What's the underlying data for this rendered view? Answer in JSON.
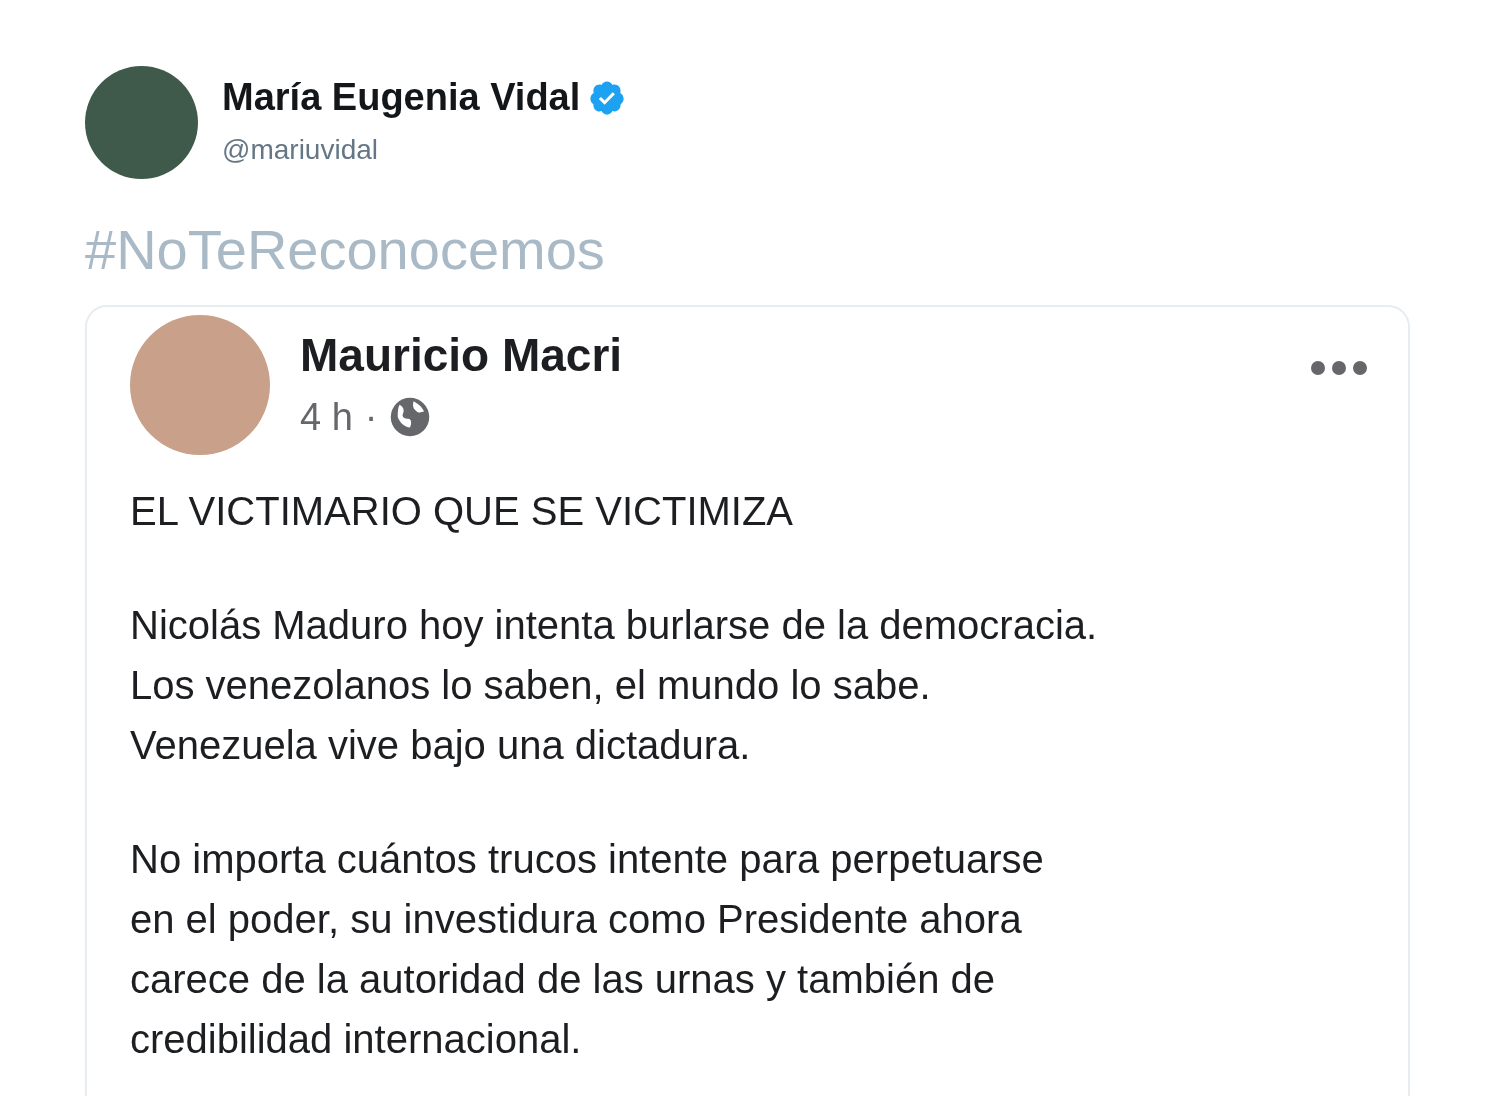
{
  "tweet": {
    "author": {
      "name": "María Eugenia Vidal",
      "verified": true,
      "handle": "@mariuvidal"
    },
    "hashtag": "#NoTeReconocemos",
    "quoted_post": {
      "author": "Mauricio Macri",
      "time": "4 h",
      "separator": "·",
      "paragraphs": [
        {
          "lines": [
            "EL VICTIMARIO QUE SE VICTIMIZA"
          ]
        },
        {
          "lines": [
            "Nicolás Maduro hoy intenta burlarse de la democracia.",
            "Los venezolanos lo saben, el mundo lo sabe.",
            "Venezuela vive bajo una dictadura."
          ]
        },
        {
          "lines": [
            "No importa cuántos trucos intente para perpetuarse",
            "en el poder, su investidura como Presidente ahora",
            "carece de la autoridad de las urnas y también de",
            "credibilidad internacional."
          ]
        }
      ]
    }
  }
}
